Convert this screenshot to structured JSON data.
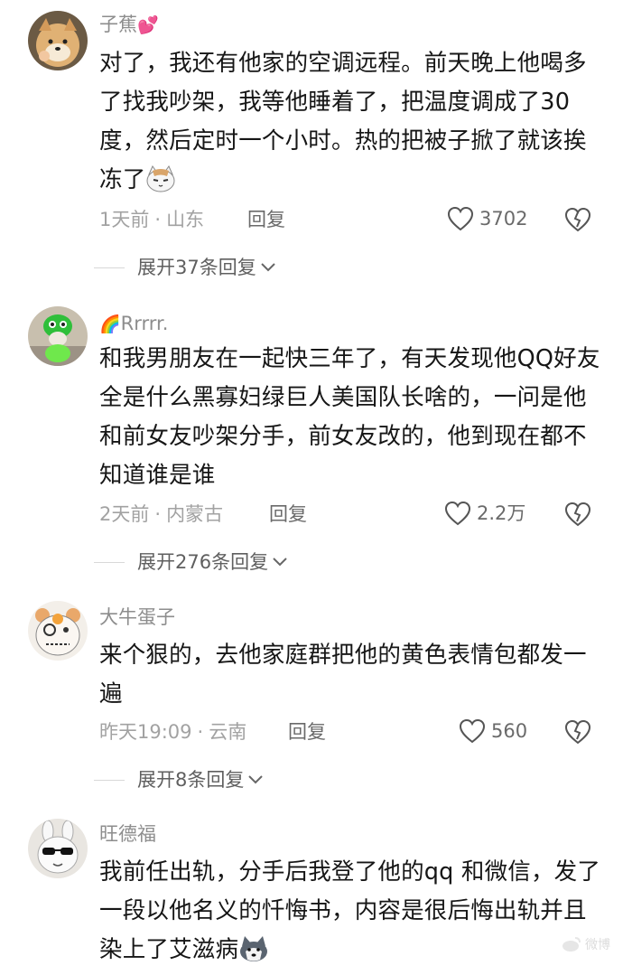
{
  "comments": [
    {
      "username": "子蕉",
      "username_emoji": "💕",
      "avatar_icon": "shiba-dog-avatar",
      "text": "对了，我还有他家的空调远程。前天晚上他喝多了找我吵架，我等他睡着了，把温度调成了30度，然后定时一个小时。热的把被子掀了就该挨冻了",
      "text_emoji": "cat-face-icon",
      "time": "1天前",
      "location": "山东",
      "reply_label": "回复",
      "likes": "3702",
      "expand_label": "展开37条回复"
    },
    {
      "username": "Rrrrr.",
      "username_emoji": "🌈",
      "avatar_icon": "green-costume-avatar",
      "text": "和我男朋友在一起快三年了，有天发现他QQ好友全是什么黑寡妇绿巨人美国队长啥的，一问是他和前女友吵架分手，前女友改的，他到现在都不知道谁是谁",
      "time": "2天前",
      "location": "内蒙古",
      "reply_label": "回复",
      "likes": "2.2万",
      "expand_label": "展开276条回复"
    },
    {
      "username": "大牛蛋子",
      "avatar_icon": "cartoon-bear-avatar",
      "text": "来个狠的，去他家庭群把他的黄色表情包都发一遍",
      "time": "昨天19:09",
      "location": "云南",
      "reply_label": "回复",
      "likes": "560",
      "expand_label": "展开8条回复"
    },
    {
      "username": "旺德福",
      "avatar_icon": "sunglasses-bunny-avatar",
      "text": "我前任出轨，分手后我登了他的qq 和微信，发了一段以他名义的忏悔书，内容是很后悔出轨并且染上了艾滋病",
      "text_emoji": "husky-dog-icon"
    }
  ],
  "watermark": "微博"
}
